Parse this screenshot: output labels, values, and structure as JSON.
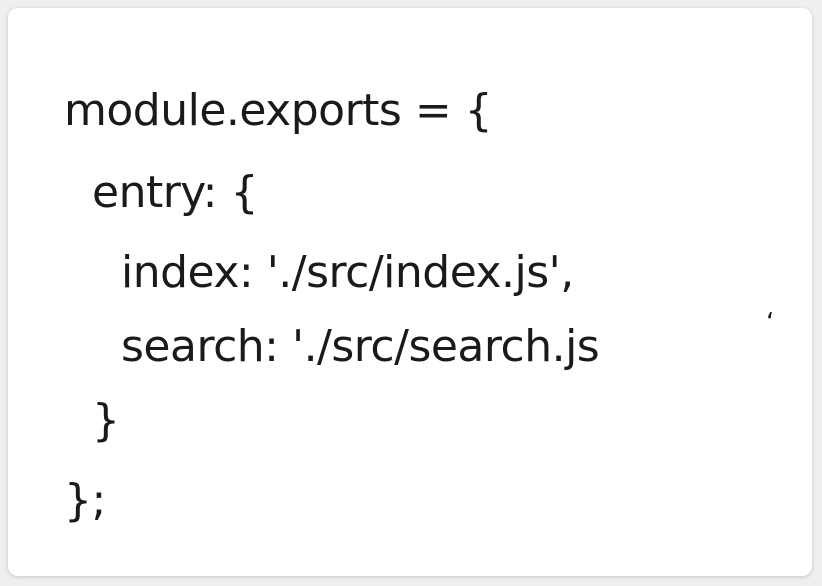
{
  "code": {
    "lines": [
      "module.exports = {",
      "entry: {",
      "index: './src/index.js',",
      "search: './src/search.js",
      "}",
      "};"
    ],
    "stray_mark": "‘"
  }
}
